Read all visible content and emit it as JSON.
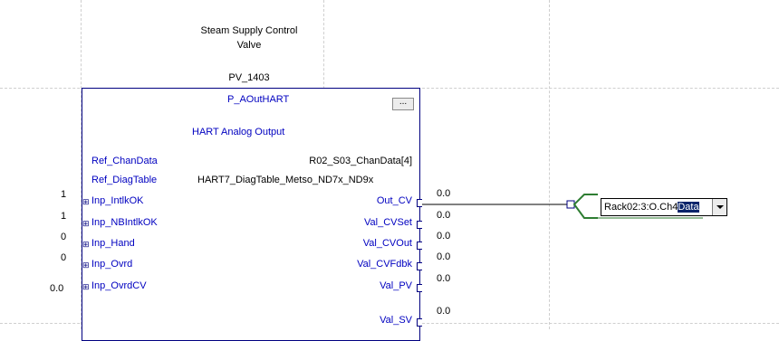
{
  "description": {
    "line1": "Steam Supply Control",
    "line2": "Valve"
  },
  "tag_name": "PV_1403",
  "block": {
    "type": "P_AOutHART",
    "subtitle": "HART Analog Output",
    "ellipsis_label": "...",
    "refs": [
      {
        "name": "Ref_ChanData",
        "value": "R02_S03_ChanData[4]"
      },
      {
        "name": "Ref_DiagTable",
        "value": "HART7_DiagTable_Metso_ND7x_ND9x"
      }
    ],
    "inputs": [
      {
        "value": "1",
        "name": "Inp_IntlkOK"
      },
      {
        "value": "1",
        "name": "Inp_NBIntlkOK"
      },
      {
        "value": "0",
        "name": "Inp_Hand"
      },
      {
        "value": "0",
        "name": "Inp_Ovrd"
      },
      {
        "value": "0.0",
        "name": "Inp_OvrdCV"
      }
    ],
    "outputs": [
      {
        "value": "0.0",
        "name": "Out_CV"
      },
      {
        "value": "0.0",
        "name": "Val_CVSet"
      },
      {
        "value": "0.0",
        "name": "Val_CVOut"
      },
      {
        "value": "0.0",
        "name": "Val_CVFdbk"
      },
      {
        "value": "0.0",
        "name": "Val_PV"
      },
      {
        "value": "0.0",
        "name": "Val_SV"
      }
    ]
  },
  "output_reference": {
    "text_prefix": "Rack02:3:O.Ch4",
    "text_selected": "Data"
  },
  "colors": {
    "pin_label": "#0000c0",
    "block_border": "#000080",
    "output_connector": "#2e7d32"
  }
}
